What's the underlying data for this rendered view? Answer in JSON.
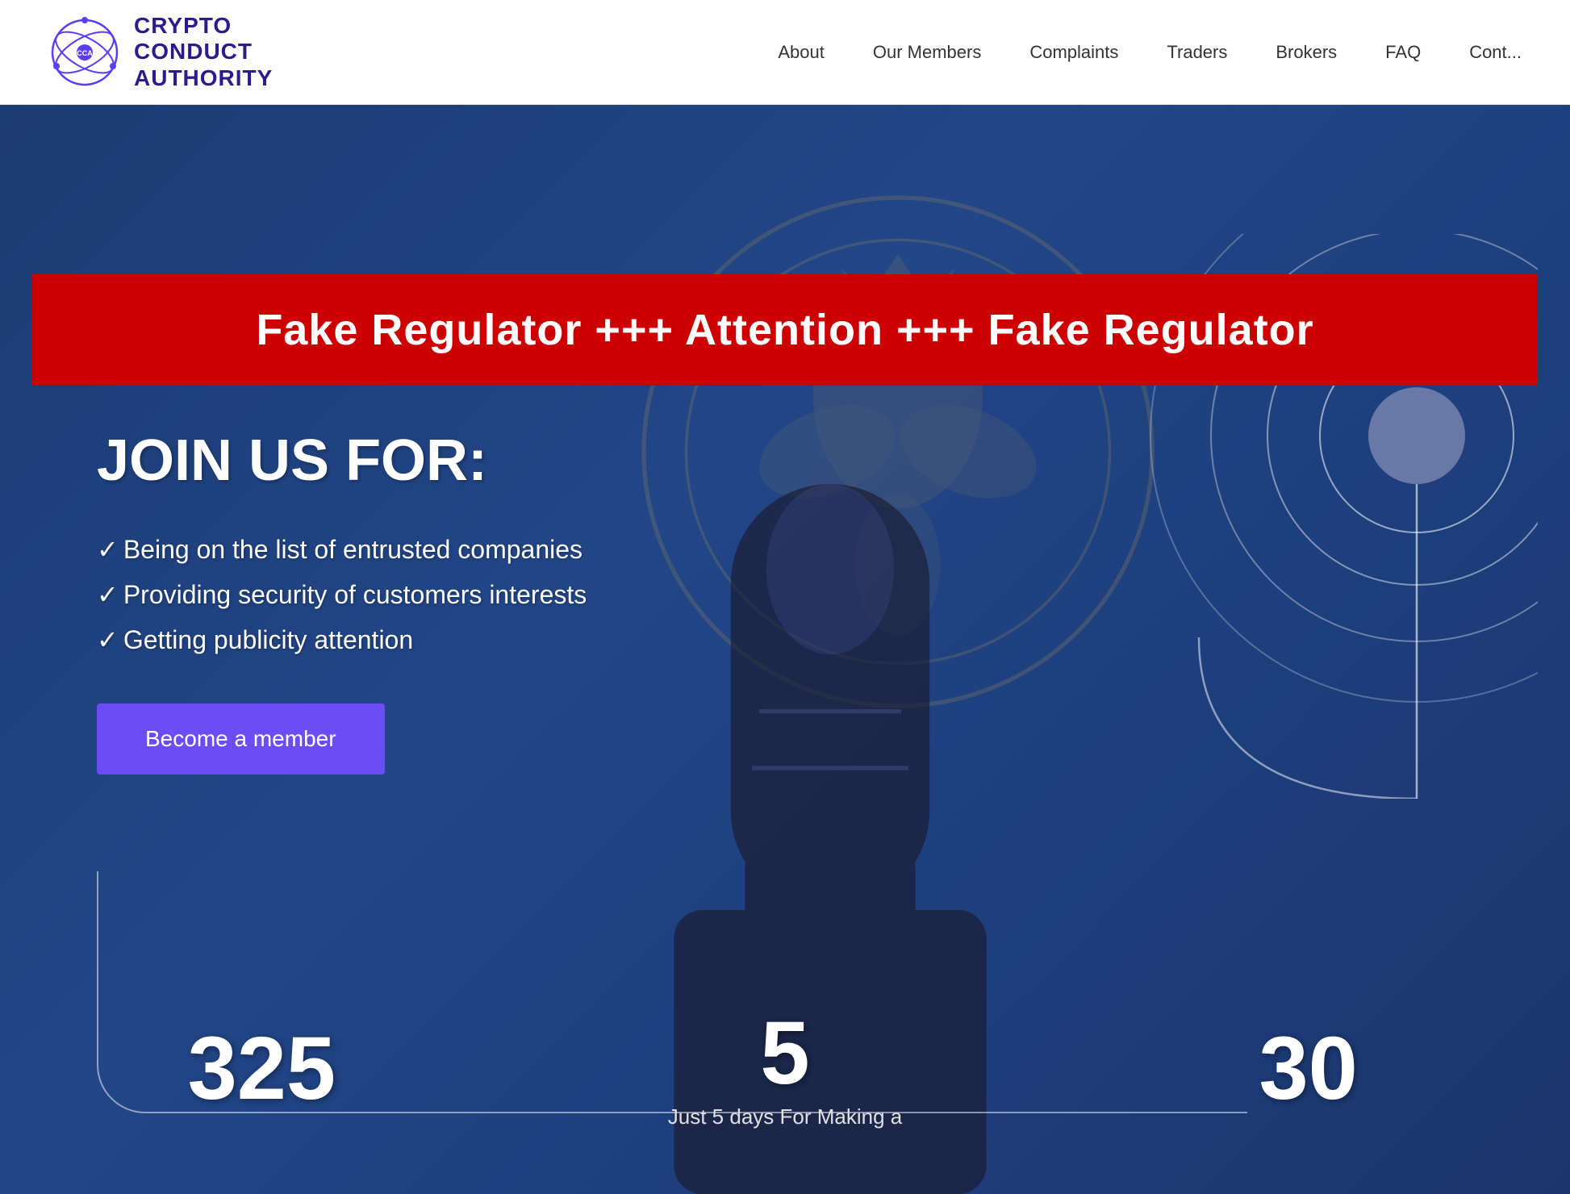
{
  "header": {
    "logo": {
      "line1": "CRYPTO",
      "line2": "CONDUCT",
      "line3": "AUTHORITY",
      "abbr": "CCA"
    },
    "nav": {
      "items": [
        {
          "label": "About",
          "id": "about"
        },
        {
          "label": "Our Members",
          "id": "our-members"
        },
        {
          "label": "Complaints",
          "id": "complaints"
        },
        {
          "label": "Traders",
          "id": "traders"
        },
        {
          "label": "Brokers",
          "id": "brokers"
        },
        {
          "label": "FAQ",
          "id": "faq"
        },
        {
          "label": "Cont...",
          "id": "contact"
        }
      ]
    }
  },
  "hero": {
    "alert": {
      "text": "Fake Regulator +++ Attention +++ Fake Regulator"
    },
    "title": "JOIN US FOR:",
    "list": [
      "Being on the list of entrusted companies",
      "Providing security of customers interests",
      "Getting publicity attention"
    ],
    "cta_button": "Become a member",
    "stats": [
      {
        "number": "325",
        "label": ""
      },
      {
        "number": "5",
        "label": "Just 5 days For Making a"
      },
      {
        "number": "30",
        "label": ""
      }
    ]
  },
  "colors": {
    "primary": "#2d1b8e",
    "accent": "#6b4df5",
    "alert_bg": "#cc0000",
    "alert_text": "#ffffff",
    "hero_bg_start": "#1a3a6e",
    "hero_bg_end": "#1a3060",
    "nav_text": "#333333"
  }
}
